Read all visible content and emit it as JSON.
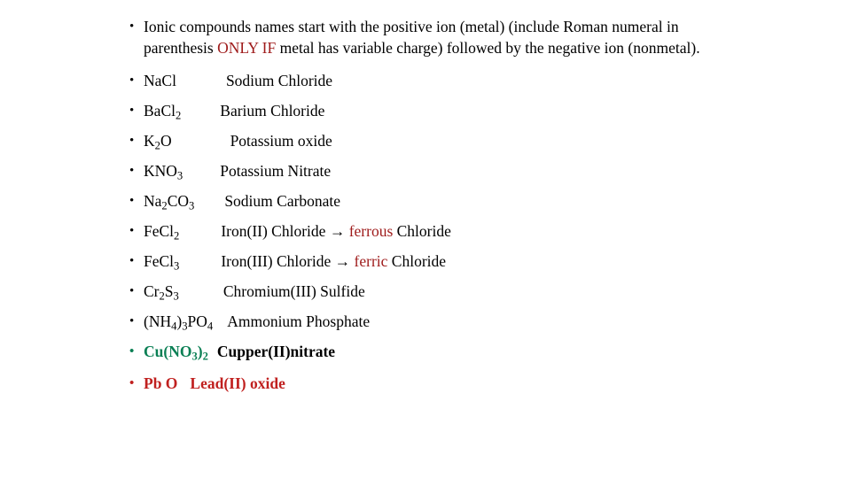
{
  "slide": {
    "background_color": "#ffffff",
    "text_color": "#000000",
    "accent_red_dark": "#9e1a1a",
    "accent_red_bright": "#c0201f",
    "accent_green": "#0a7f54",
    "bullet_glyph": "•",
    "arrow_glyph": "→"
  },
  "intro": {
    "part1": "Ionic compounds names start with the positive ion (metal) (include Roman numeral in parenthesis ",
    "highlight": "ONLY IF",
    "part2": " metal has variable charge) followed by the negative ion (nonmetal)."
  },
  "examples": [
    {
      "formula_prefix": "NaCl",
      "formula_sub": "",
      "formula_suffix": "",
      "name": "Sodium Chloride",
      "gap": 56
    },
    {
      "formula_prefix": "BaCl",
      "formula_sub": "2",
      "formula_suffix": "",
      "name": "Barium Chloride",
      "gap": 44
    },
    {
      "formula_prefix": "K",
      "formula_sub": "2",
      "formula_suffix": "O",
      "name": "Potassium oxide",
      "gap": 66
    },
    {
      "formula_prefix": "KNO",
      "formula_sub": "3",
      "formula_suffix": "",
      "name": "Potassium Nitrate",
      "gap": 42
    },
    {
      "formula_prefix": "Na",
      "formula_sub": "2",
      "formula_suffix": "CO",
      "formula_sub2": "3",
      "name": "Sodium Carbonate",
      "gap": 34
    },
    {
      "formula_prefix": "FeCl",
      "formula_sub": "2",
      "formula_suffix": "",
      "name": "Iron(II) Chloride",
      "arrow": "→",
      "emph": "ferrous",
      "emph_color": "red-dark",
      "name_tail": "Chloride",
      "gap": 47
    },
    {
      "formula_prefix": "FeCl",
      "formula_sub": "3",
      "formula_suffix": "",
      "name": "Iron(III) Chloride",
      "arrow": "→",
      "emph": "ferric",
      "emph_color": "red-dark",
      "name_tail": "Chloride",
      "gap": 47
    },
    {
      "formula_prefix": "Cr",
      "formula_sub": "2",
      "formula_suffix": "S",
      "formula_sub2": "3",
      "name": "Chromium(III) Sulfide",
      "gap": 50
    },
    {
      "formula_prefix": "(NH",
      "formula_sub": "4",
      "formula_mid": ")",
      "formula_sub_mid": "3",
      "formula_suffix": "PO",
      "formula_sub2": "4",
      "name": "Ammonium Phosphate",
      "gap": 16
    }
  ],
  "highlighted": [
    {
      "formula_prefix": "Cu(NO",
      "formula_sub": "3",
      "formula_mid": ")",
      "formula_sub_mid": "2",
      "formula_color": "green",
      "name": "Cupper(II)nitrate",
      "name_color": "",
      "bullet_color": "green",
      "gap": 10
    },
    {
      "formula_prefix": "Pb O",
      "formula_sub": "",
      "formula_color": "red-bright",
      "name": "Lead(II)  oxide",
      "name_color": "red-bright",
      "bullet_color": "red-bright",
      "gap": 14
    }
  ]
}
